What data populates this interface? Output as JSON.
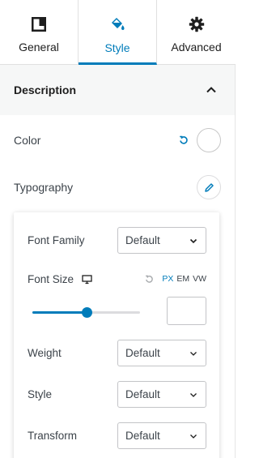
{
  "tabs": [
    {
      "label": "General",
      "icon": "layout-icon",
      "active": false
    },
    {
      "label": "Style",
      "icon": "paint-bucket-icon",
      "active": true
    },
    {
      "label": "Advanced",
      "icon": "gear-icon",
      "active": false
    }
  ],
  "section": {
    "title": "Description",
    "expanded": true
  },
  "color": {
    "label": "Color",
    "value": "#ffffff"
  },
  "typography": {
    "label": "Typography",
    "font_family": {
      "label": "Font Family",
      "value": "Default"
    },
    "font_size": {
      "label": "Font Size",
      "units": [
        "PX",
        "EM",
        "VW"
      ],
      "active_unit": "PX",
      "slider_level": 0.5,
      "value": ""
    },
    "weight": {
      "label": "Weight",
      "value": "Default"
    },
    "style": {
      "label": "Style",
      "value": "Default"
    },
    "transform": {
      "label": "Transform",
      "value": "Default"
    }
  },
  "colors": {
    "accent": "#007cba",
    "text": "#1e1e1e",
    "muted": "#3c434a",
    "header_bg": "#f6f7f7"
  }
}
